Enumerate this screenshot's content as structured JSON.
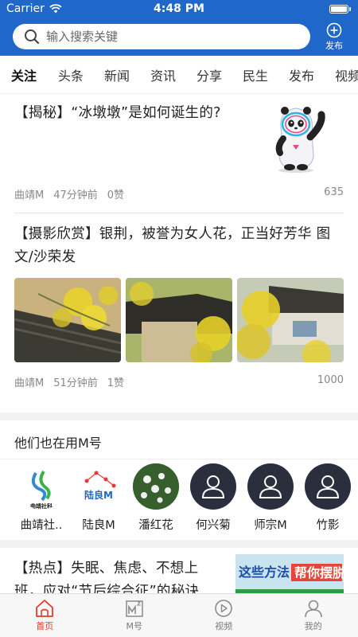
{
  "status": {
    "carrier": "Carrier",
    "time": "4:48 PM"
  },
  "search": {
    "placeholder": "输入搜索关键",
    "publish_label": "发布"
  },
  "tabs": [
    {
      "label": "关注",
      "active": true
    },
    {
      "label": "头条"
    },
    {
      "label": "新闻"
    },
    {
      "label": "资讯"
    },
    {
      "label": "分享"
    },
    {
      "label": "民生"
    },
    {
      "label": "发布"
    },
    {
      "label": "视频"
    }
  ],
  "articles": [
    {
      "title": "【揭秘】“冰墩墩”是如何诞生的?",
      "author": "曲靖M",
      "time": "47分钟前",
      "likes": "0赞",
      "views": "635",
      "image": "bing-dwen-dwen-mascot"
    },
    {
      "title": "【摄影欣赏】银荆，被誉为女人花，正当好芳华   图文/沙荣发",
      "author": "曲靖M",
      "time": "51分钟前",
      "likes": "1赞",
      "views": "1000",
      "images": [
        "yellow-flowers-roof-1",
        "yellow-flowers-roof-2",
        "yellow-flowers-house-3"
      ]
    }
  ],
  "recommend": {
    "heading": "他们也在用M号",
    "people": [
      {
        "name": "曲靖社..",
        "avatar": "qujing-logo",
        "logo_text": "曲靖社科"
      },
      {
        "name": "陆良M",
        "avatar": "luliang-logo",
        "logo_text": "陆良M"
      },
      {
        "name": "潘红花",
        "avatar": "flower-photo"
      },
      {
        "name": "何兴菊",
        "avatar": "default-user-icon"
      },
      {
        "name": "师宗M",
        "avatar": "default-user-icon"
      },
      {
        "name": "竹影",
        "avatar": "default-user-icon"
      }
    ]
  },
  "article3": {
    "title": "【热点】失眠、焦虑、不想上班，应对“节后综合征”的秘诀",
    "thumb_text_1": "这些方法",
    "thumb_text_2": "帮你摆脱"
  },
  "tabbar": [
    {
      "label": "首页",
      "icon": "home-icon",
      "active": true
    },
    {
      "label": "M号",
      "icon": "m-number-icon"
    },
    {
      "label": "视频",
      "icon": "play-circle-icon"
    },
    {
      "label": "我的",
      "icon": "user-icon"
    }
  ],
  "colors": {
    "brand": "#1f67c8",
    "active_tab": "#e63b2e"
  }
}
